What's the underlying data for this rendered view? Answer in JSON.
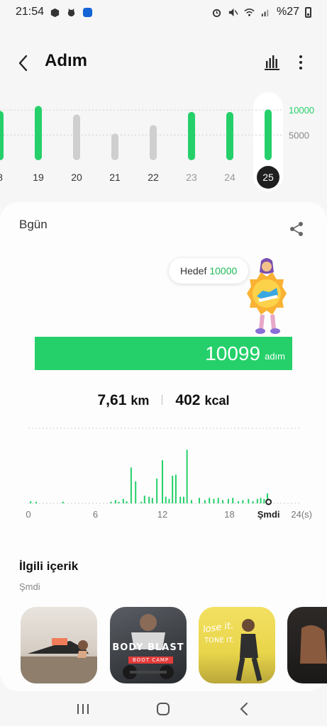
{
  "status_bar": {
    "time": "21:54",
    "battery": "%27",
    "left_icons": [
      "box-icon",
      "cat-icon",
      "app-badge-icon"
    ],
    "right_icons": [
      "alarm-icon",
      "mute-icon",
      "wifi-icon",
      "signal-icon",
      "battery-icon"
    ]
  },
  "header": {
    "title": "Adım",
    "back_icon": "chevron-left-icon",
    "chart_icon": "bar-chart-icon",
    "more_icon": "more-vertical-icon"
  },
  "week_chart": {
    "days": [
      "8",
      "19",
      "20",
      "21",
      "22",
      "23",
      "24",
      "25"
    ],
    "steps": [
      9800,
      10800,
      9100,
      5300,
      7000,
      9600,
      9600,
      10099
    ],
    "goal_met": [
      true,
      true,
      false,
      false,
      false,
      true,
      true,
      true
    ],
    "selected_day": "25",
    "axis_labels": [
      "10000",
      "5000"
    ],
    "colors": {
      "met": "#25d06a",
      "unmet": "#cfcfcf",
      "selected": "#1f1f1f",
      "goal_label": "#25d06a"
    }
  },
  "today": {
    "label": "Bgün",
    "share_icon": "share-icon",
    "goal_label": "Hedef",
    "goal_value": "10000",
    "steps_value": "10099",
    "steps_unit": "adım",
    "progress": 1.0,
    "distance_value": "7,61",
    "distance_unit": "km",
    "calories_value": "402",
    "calories_unit": "kcal"
  },
  "hourly_chart": {
    "x_labels": [
      "0",
      "6",
      "12",
      "18",
      "Şmdi",
      "24(s)"
    ],
    "hours_from": 0,
    "hours_to": 24,
    "now_hour": 21.5,
    "bars": [
      [
        0.2,
        4
      ],
      [
        0.7,
        3
      ],
      [
        3.1,
        3
      ],
      [
        7.4,
        3
      ],
      [
        7.8,
        6
      ],
      [
        8.1,
        3
      ],
      [
        8.5,
        8
      ],
      [
        8.8,
        4
      ],
      [
        9.2,
        65
      ],
      [
        9.6,
        40
      ],
      [
        10.1,
        3
      ],
      [
        10.4,
        14
      ],
      [
        10.8,
        12
      ],
      [
        11.1,
        10
      ],
      [
        11.5,
        45
      ],
      [
        12.0,
        78
      ],
      [
        12.3,
        12
      ],
      [
        12.6,
        8
      ],
      [
        12.9,
        50
      ],
      [
        13.2,
        52
      ],
      [
        13.6,
        12
      ],
      [
        13.9,
        12
      ],
      [
        14.2,
        97
      ],
      [
        14.6,
        6
      ],
      [
        15.3,
        10
      ],
      [
        15.8,
        6
      ],
      [
        16.2,
        10
      ],
      [
        16.6,
        8
      ],
      [
        17.0,
        10
      ],
      [
        17.4,
        6
      ],
      [
        17.9,
        8
      ],
      [
        18.3,
        10
      ],
      [
        18.8,
        4
      ],
      [
        19.2,
        6
      ],
      [
        19.7,
        8
      ],
      [
        20.1,
        4
      ],
      [
        20.5,
        8
      ],
      [
        20.8,
        10
      ],
      [
        21.1,
        8
      ],
      [
        21.4,
        18
      ]
    ],
    "color": "#25d06a"
  },
  "related": {
    "title": "İlgili içerik",
    "subtitle": "Şmdi",
    "thumbs": [
      {
        "name": "thumb-plank"
      },
      {
        "name": "thumb-body-blast",
        "title": "BODY BLAST",
        "sub": "BOOT CAMP"
      },
      {
        "name": "thumb-lose-it",
        "title": "lose it.",
        "sub": "TONE IT."
      },
      {
        "name": "thumb-fitness"
      }
    ]
  },
  "nav": {
    "recent_icon": "recent-apps-icon",
    "home_icon": "home-icon",
    "back_icon": "back-icon"
  }
}
